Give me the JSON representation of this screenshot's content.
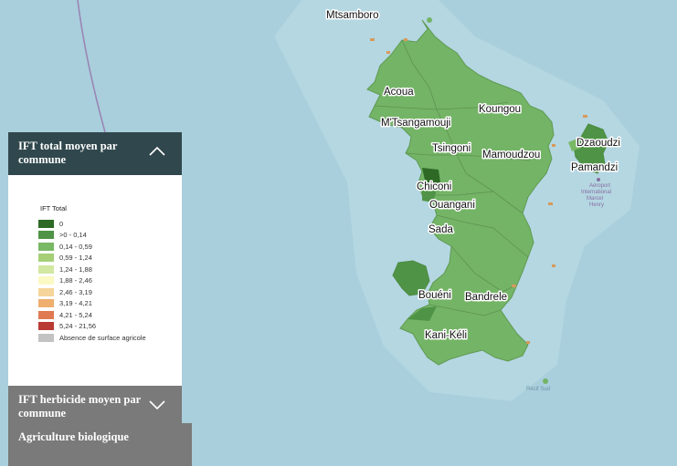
{
  "colors": {
    "sea": "#a9cfdc",
    "land": "#74b466",
    "panel_header": "#30484d",
    "panel_collapsed": "#7a7a7a"
  },
  "map": {
    "towns": [
      "Mtsamboro",
      "Acoua",
      "M'Tsangamouji",
      "Koungou",
      "Tsingoni",
      "Mamoudzou",
      "Dzaoudzi",
      "Pamandzi",
      "Chiconi",
      "Ouangani",
      "Sada",
      "Bouéni",
      "Bandrele",
      "Kani-Kéli"
    ],
    "airport_lines": [
      "Aéroport",
      "International",
      "Marcel",
      "Henry"
    ],
    "sea_label_lines": [
      "Récif Sud"
    ]
  },
  "panel": {
    "section1_title": "IFT total moyen par commune",
    "legend_title": "IFT Total",
    "legend": [
      {
        "label": "0",
        "color": "#2e6a26"
      },
      {
        "label": ">0  - 0,14",
        "color": "#4f9446"
      },
      {
        "label": "0,14 - 0,59",
        "color": "#79b865"
      },
      {
        "label": "0,59 - 1,24",
        "color": "#a6cf77"
      },
      {
        "label": "1,24 - 1,88",
        "color": "#d2e7a2"
      },
      {
        "label": "1,88 - 2,46",
        "color": "#fbf9c4"
      },
      {
        "label": "2,46 - 3,19",
        "color": "#f6d59a"
      },
      {
        "label": "3,19 - 4,21",
        "color": "#efaf6e"
      },
      {
        "label": "4,21 - 5,24",
        "color": "#e07a52"
      },
      {
        "label": "5,24 - 21,56",
        "color": "#b93a34"
      },
      {
        "label": "Absence de surface agricole",
        "color": "#c2c2c2"
      }
    ],
    "section2_title": "IFT herbicide moyen par commune",
    "section3_title": "Agriculture biologique"
  }
}
